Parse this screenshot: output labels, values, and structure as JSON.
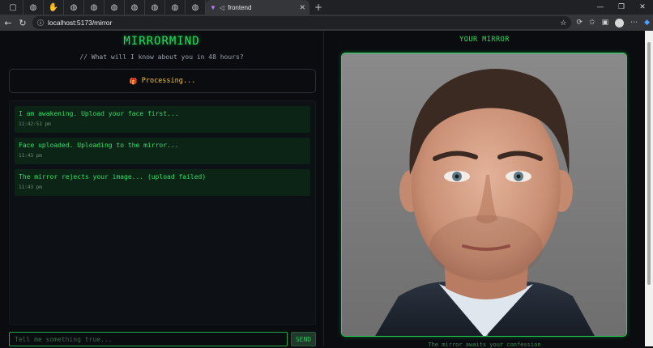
{
  "browser": {
    "tab_title": "frontend",
    "url": "localhost:5173/mirror",
    "pinned_tabs": [
      "globe-icon",
      "globe-icon",
      "hand-icon",
      "globe-icon",
      "globe-icon",
      "globe-icon",
      "globe-icon",
      "globe-icon",
      "globe-icon",
      "globe-icon"
    ]
  },
  "app": {
    "brand": "MIRRORMIND",
    "tagline": "// What will I know about you in 48 hours?",
    "status": "Processing...",
    "messages": [
      {
        "text": "I am awakening. Upload your face first...",
        "time": "11:42:51 pm"
      },
      {
        "text": "Face uploaded. Uploading to the mirror...",
        "time": "11:43 pm"
      },
      {
        "text": "The mirror rejects your image... (upload failed)",
        "time": "11:43 pm"
      }
    ],
    "input_placeholder": "Tell me something true...",
    "send_label": "SEND",
    "mirror_title": "YOUR MIRROR",
    "mirror_caption": "The mirror awaits your confession",
    "accent": "#22e05a",
    "warning": "#f2c230"
  }
}
